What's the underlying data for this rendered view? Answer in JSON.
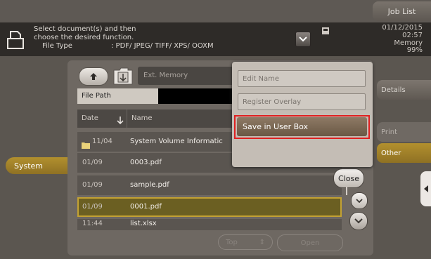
{
  "header": {
    "job_list_label": "Job List",
    "message_line1": "Select document(s) and then",
    "message_line2": "choose the desired function.",
    "file_type_label": "File Type",
    "file_type_value": ": PDF/ JPEG/ TIFF/ XPS/ OOXM",
    "date": "01/12/2015",
    "time": "02:57",
    "memory_label": "Memory",
    "memory_value": "99%"
  },
  "left_tabs": {
    "system": "System"
  },
  "browser": {
    "location_label": "Ext. Memory",
    "file_path_label": "File Path",
    "columns": {
      "date": "Date",
      "name": "Name"
    },
    "rows": [
      {
        "date": "11/04",
        "name": "System Volume Informatic",
        "is_folder": true
      },
      {
        "date": "01/09",
        "name": "0003.pdf"
      },
      {
        "date": "01/09",
        "name": "sample.pdf"
      },
      {
        "date": "01/09",
        "name": "0001.pdf",
        "selected": true
      },
      {
        "date": "11:44",
        "name": "list.xlsx"
      }
    ],
    "top_label": "Top",
    "open_label": "Open",
    "close_label": "Close"
  },
  "popup_menu": {
    "edit_name": "Edit Name",
    "register_overlay": "Register Overlay",
    "save_in_user_box": "Save in User Box"
  },
  "right_tabs": {
    "details": "Details",
    "print": "Print",
    "other": "Other"
  },
  "colors": {
    "accent_gold": "#b2902e",
    "highlight_red": "#e02020"
  }
}
